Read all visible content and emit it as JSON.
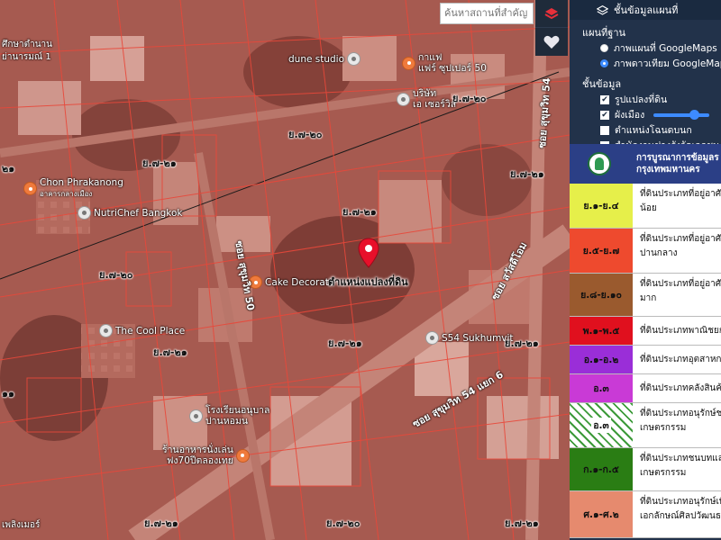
{
  "search": {
    "placeholder": "ค้นหาสถานที่สำคัญ"
  },
  "panel": {
    "title": "ชั้นข้อมูลแผนที่",
    "basemap_title": "แผนที่ฐาน",
    "basemap_options": [
      {
        "label": "ภาพแผนที่ GoogleMaps",
        "selected": false
      },
      {
        "label": "ภาพดาวเทียม GoogleMaps",
        "selected": true
      }
    ],
    "layers_title": "ชั้นข้อมูล",
    "layers": [
      {
        "label": "รูปแปลงที่ดิน",
        "checked": true
      },
      {
        "label": "ผังเมือง",
        "checked": true
      },
      {
        "label": "ตำแหน่งโฉนดบนก",
        "checked": false
      },
      {
        "label": "สำนักงานช่างรังวัดเอกชน",
        "checked": false
      }
    ]
  },
  "legend": {
    "header_line1": "การบูรณาการข้อมูลร",
    "header_line2": "กรุงเทพมหานคร",
    "rows": [
      {
        "code": "ย.๑-ย.๔",
        "color": "#e6ef4a",
        "desc1": "ที่ดินประเภทที่อยู่อาศั",
        "desc2": "น้อย"
      },
      {
        "code": "ย.๕-ย.๗",
        "color": "#ee4a2e",
        "desc1": "ที่ดินประเภทที่อยู่อาศั",
        "desc2": "ปานกลาง"
      },
      {
        "code": "ย.๘-ย.๑๐",
        "color": "#9a5a2e",
        "desc1": "ที่ดินประเภทที่อยู่อาศั",
        "desc2": "มาก"
      },
      {
        "code": "พ.๑-พ.๕",
        "color": "#e0101e",
        "desc1": "ที่ดินประเภทพาณิชยก",
        "desc2": ""
      },
      {
        "code": "อ.๑-อ.๒",
        "color": "#9a2ed8",
        "desc1": "ที่ดินประเภทอุตสาหกร",
        "desc2": ""
      },
      {
        "code": "อ.๓",
        "color": "#c93ad6",
        "desc1": "ที่ดินประเภทคลังสินค้",
        "desc2": ""
      },
      {
        "code": "ก.๑-ก.๕",
        "color": "#2a7d14",
        "desc1": "ที่ดินประเภทชนบทและ",
        "desc2": "เกษตรกรรม"
      },
      {
        "code": "ศ.๑-ศ.๒",
        "color": "#e68a6e",
        "desc1": "ที่ดินประเภทอนุรักษ์เพื่",
        "desc2": "เอกลักษณ์ศิลปวัฒนธ"
      }
    ],
    "hatched_row": {
      "code": "อ.๓",
      "desc1": "ที่ดินประเภทอนุรักษ์ชน",
      "desc2": "เกษตรกรรม"
    }
  },
  "map": {
    "marker_label": "ตำแหน่งแปลงที่ดิน",
    "pois": [
      {
        "name": "Chon Phrakanong",
        "sub": "อาคารกลางเมือง",
        "icon": "orange"
      },
      {
        "name": "NutriChef Bangkok",
        "sub": "",
        "icon": "grey"
      },
      {
        "name": "Cake Decorate",
        "sub": "",
        "icon": "orange"
      },
      {
        "name": "The Cool Place",
        "sub": "",
        "icon": "grey"
      },
      {
        "name": "dune studio",
        "sub": "",
        "icon": "grey"
      },
      {
        "name": "S54 Sukhumvit",
        "sub": "",
        "icon": "grey"
      },
      {
        "name": "โรงเรียนอนุบาล",
        "sub": "ปานหอมน",
        "icon": "grey"
      },
      {
        "name": "ร้านอาหารนั่งเล่น",
        "sub": "ฟง70ปีตลองเทย",
        "icon": "orange"
      },
      {
        "name": "กาแฟ",
        "sub": "แฟร์ ซุปเปอร์ 50",
        "icon": "orange"
      },
      {
        "name": "บริษัท",
        "sub": "เอ เซอร์วิส",
        "icon": "grey"
      }
    ],
    "zones": [
      "ย.๗-๒๑",
      "ย.๗-๒๐",
      "ย.๗-๒๑",
      "ย.๗-๒๐",
      "ย.๗-๒๑",
      "ย.๗-๒๐",
      "ย.๗-๒๑",
      "ย.๗-๒๑",
      "ย.๗-๒๑",
      "ย.๗-๒๑",
      "ย.๗-๒๐",
      "ย.๗-๒๑"
    ],
    "streets": [
      "ซอย สุขุมวิท 54 แยก 6",
      "ซอย สุขุมวิท 50",
      "ซอย สวัสดีโอม",
      "ซอย สุขุมวิท 54"
    ],
    "edge_labels": [
      "ศึกษาตำนาน",
      "ย่านารมณ์ 1",
      "เพลิงเมอร์",
      "๒๑",
      "๑๑"
    ]
  }
}
